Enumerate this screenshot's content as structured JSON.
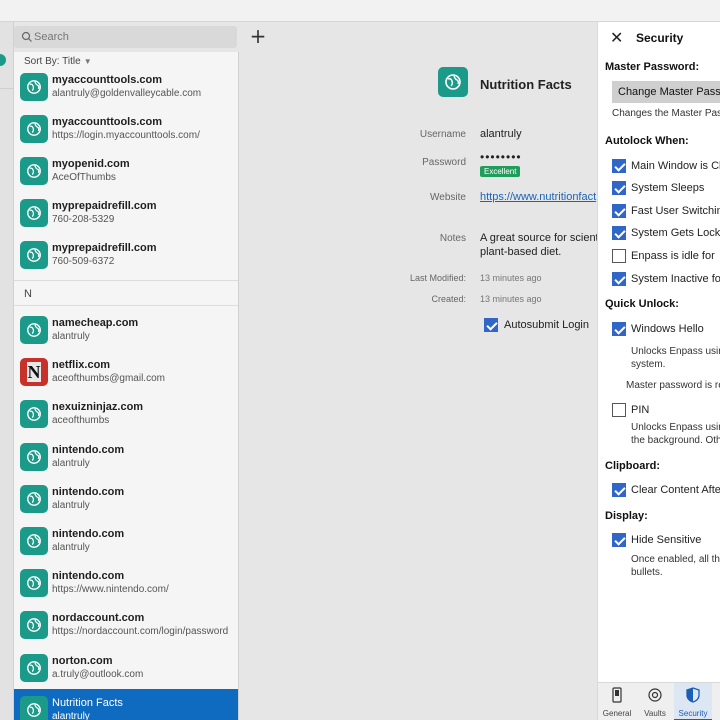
{
  "search": {
    "placeholder": "Search"
  },
  "list": {
    "sort_label": "Sort By: Title",
    "items_top": [
      {
        "title": "myaccounttools.com",
        "subtitle": "alantruly@goldenvalleycable.com"
      },
      {
        "title": "myaccounttools.com",
        "subtitle": "https://login.myaccounttools.com/"
      },
      {
        "title": "myopenid.com",
        "subtitle": "AceOfThumbs"
      },
      {
        "title": "myprepaidrefill.com",
        "subtitle": "760-208-5329"
      },
      {
        "title": "myprepaidrefill.com",
        "subtitle": "760-509-6372"
      }
    ],
    "section_letter": "N",
    "items_n": [
      {
        "title": "namecheap.com",
        "subtitle": "alantruly",
        "icon": "globe-icon"
      },
      {
        "title": "netflix.com",
        "subtitle": "aceofthumbs@gmail.com",
        "icon": "netflix-icon",
        "icon_letter": "N"
      },
      {
        "title": "nexuizninjaz.com",
        "subtitle": "aceofthumbs",
        "icon": "globe-icon"
      },
      {
        "title": "nintendo.com",
        "subtitle": "alantruly",
        "icon": "globe-icon"
      },
      {
        "title": "nintendo.com",
        "subtitle": "alantruly",
        "icon": "globe-icon"
      },
      {
        "title": "nintendo.com",
        "subtitle": "alantruly",
        "icon": "globe-icon"
      },
      {
        "title": "nintendo.com",
        "subtitle": "https://www.nintendo.com/",
        "icon": "globe-icon"
      },
      {
        "title": "nordaccount.com",
        "subtitle": "https://nordaccount.com/login/password",
        "icon": "globe-icon"
      },
      {
        "title": "norton.com",
        "subtitle": "a.truly@outlook.com",
        "icon": "globe-icon"
      },
      {
        "title": "Nutrition Facts",
        "subtitle": "alantruly",
        "icon": "globe-icon",
        "selected": true
      }
    ]
  },
  "detail": {
    "title": "Nutrition Facts",
    "username_label": "Username",
    "username": "alantruly",
    "password_label": "Password",
    "password_mask": "••••••••",
    "strength": "Excellent",
    "website_label": "Website",
    "website": "https://www.nutritionfact",
    "notes_label": "Notes",
    "notes_line1": "A great source for scienti",
    "notes_line2": "plant-based diet.",
    "modified_label": "Last Modified:",
    "modified": "13 minutes ago",
    "created_label": "Created:",
    "created": "13 minutes ago",
    "autosubmit_label": "Autosubmit Login",
    "autosubmit_checked": true
  },
  "security": {
    "title": "Security",
    "master_password_heading": "Master Password:",
    "change_button": "Change Master Passwo",
    "change_desc": "Changes the Master Pass",
    "autolock_heading": "Autolock When:",
    "autolock_options": [
      {
        "label": "Main Window is Clo",
        "checked": true
      },
      {
        "label": "System Sleeps",
        "checked": true
      },
      {
        "label": "Fast User Switching",
        "checked": true
      },
      {
        "label": "System Gets Locked",
        "checked": true
      },
      {
        "label": "Enpass is idle for",
        "checked": false
      },
      {
        "label": "System Inactive for",
        "checked": true
      }
    ],
    "quick_unlock_heading": "Quick Unlock:",
    "windows_hello_label": "Windows Hello",
    "windows_hello_checked": true,
    "windows_hello_desc1": "Unlocks Enpass using",
    "windows_hello_desc2": "system.",
    "master_required_note": "Master password is re",
    "pin_label": "PIN",
    "pin_checked": false,
    "pin_desc1": "Unlocks Enpass using",
    "pin_desc2": "the background. Oth",
    "clipboard_heading": "Clipboard:",
    "clear_content_label": "Clear Content After",
    "clear_content_checked": true,
    "display_heading": "Display:",
    "hide_sensitive_label": "Hide Sensitive",
    "hide_sensitive_checked": true,
    "hide_sensitive_desc1": "Once enabled, all the",
    "hide_sensitive_desc2": "bullets.",
    "tabs": [
      {
        "label": "General",
        "icon": "phone-icon"
      },
      {
        "label": "Vaults",
        "icon": "vault-icon"
      },
      {
        "label": "Security",
        "icon": "shield-icon",
        "active": true
      }
    ]
  }
}
